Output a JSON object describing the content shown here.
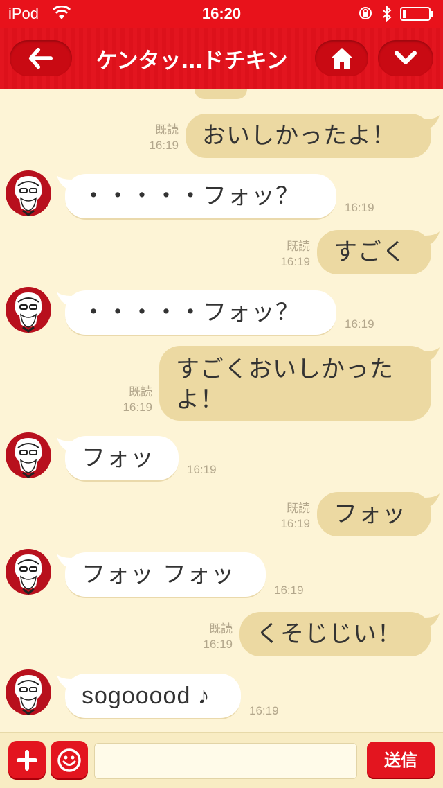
{
  "status_bar": {
    "carrier": "iPod",
    "time": "16:20",
    "icons": [
      "wifi-icon",
      "orientation-lock-icon",
      "bluetooth-icon",
      "battery-low-icon"
    ],
    "battery_level": 0.12
  },
  "nav": {
    "title": "ケンタッ…ドチキン",
    "buttons": [
      "back-arrow-icon",
      "home-icon",
      "chevron-down-icon"
    ]
  },
  "messages": [
    {
      "side": "out",
      "text": "おいしかったよ！",
      "read": "既読",
      "time": "16:19"
    },
    {
      "side": "in",
      "text": "・・・・・フォッ？",
      "time": "16:19"
    },
    {
      "side": "out",
      "text": "すごく",
      "read": "既読",
      "time": "16:19"
    },
    {
      "side": "in",
      "text": "・・・・・フォッ？",
      "time": "16:19"
    },
    {
      "side": "out",
      "text": "すごくおいしかったよ！",
      "line1": "すごくおいしかった",
      "line2": "よ！",
      "read": "既読",
      "time": "16:19"
    },
    {
      "side": "in",
      "text": "フォッ",
      "time": "16:19"
    },
    {
      "side": "out",
      "text": "フォッ",
      "read": "既読",
      "time": "16:19"
    },
    {
      "side": "in",
      "text": "フォッ フォッ",
      "time": "16:19"
    },
    {
      "side": "out",
      "text": "くそじじい！",
      "read": "既読",
      "time": "16:19"
    },
    {
      "side": "in",
      "text": "sogooood ♪",
      "time": "16:19"
    }
  ],
  "input": {
    "placeholder": "",
    "value": "",
    "send_label": "送信"
  },
  "colors": {
    "brand_red": "#e3151f",
    "chat_bg": "#fdf4d6",
    "outgoing_bubble": "#ecd9a2",
    "incoming_bubble": "#ffffff"
  }
}
